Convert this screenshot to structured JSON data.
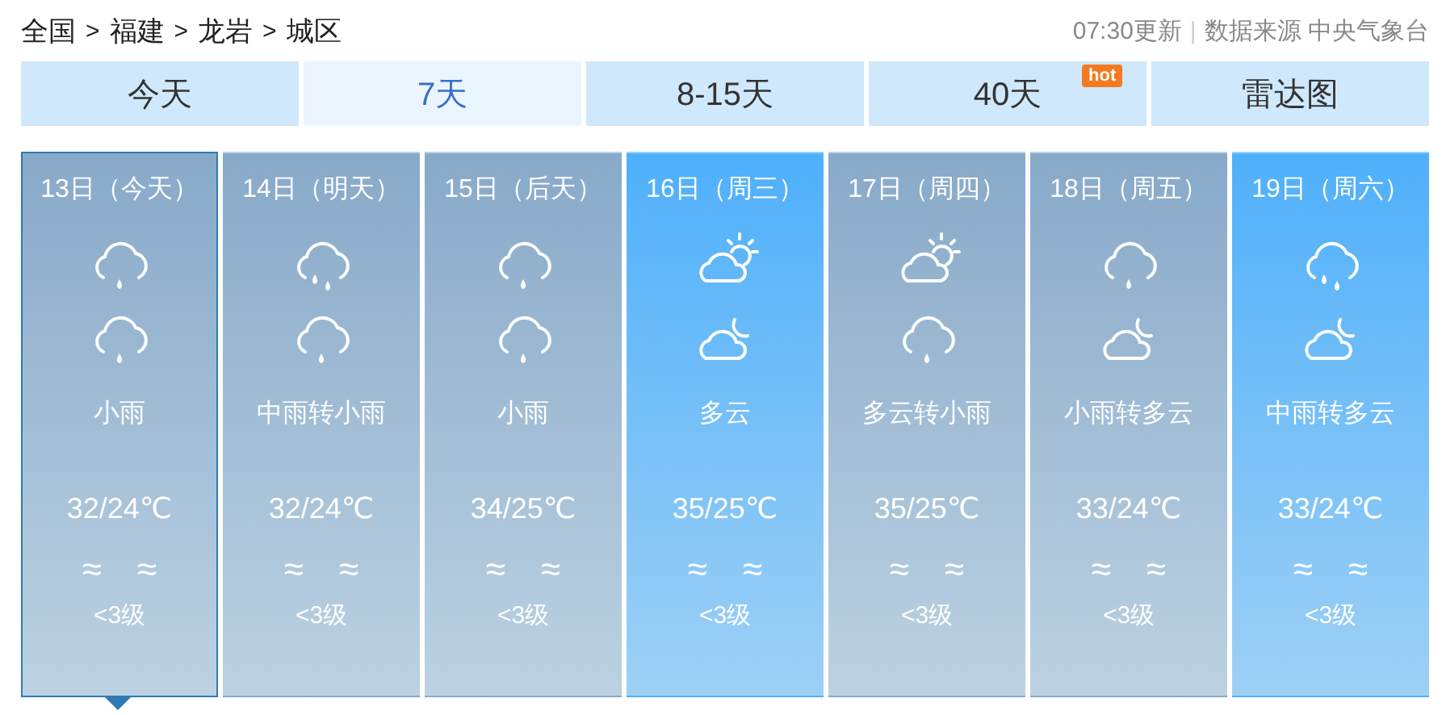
{
  "breadcrumb": {
    "items": [
      "全国",
      "福建",
      "龙岩",
      "城区"
    ],
    "separators": [
      ">",
      ">",
      ">"
    ]
  },
  "update": {
    "time": "07:30更新",
    "divider": "|",
    "source": "数据来源 中央气象台"
  },
  "tabs": [
    {
      "label": "今天",
      "selected": false
    },
    {
      "label": "7天",
      "selected": true
    },
    {
      "label": "8-15天",
      "selected": false
    },
    {
      "label": "40天",
      "selected": false,
      "badge": "hot"
    },
    {
      "label": "雷达图",
      "selected": false
    }
  ],
  "days": [
    {
      "date": "13日（今天）",
      "kind": "rain",
      "selected": true,
      "icons": [
        {
          "kind": "rain-one"
        },
        {
          "kind": "rain-one"
        }
      ],
      "weather": "小雨",
      "temp": "32/24℃",
      "wind_day": "≈",
      "wind_night": "≈",
      "wind_level": "<3级"
    },
    {
      "date": "14日（明天）",
      "kind": "rain",
      "selected": false,
      "icons": [
        {
          "kind": "rain-two"
        },
        {
          "kind": "rain-one"
        }
      ],
      "weather": "中雨转小雨",
      "temp": "32/24℃",
      "wind_day": "≈",
      "wind_night": "≈",
      "wind_level": "<3级"
    },
    {
      "date": "15日（后天）",
      "kind": "rain",
      "selected": false,
      "icons": [
        {
          "kind": "rain-one"
        },
        {
          "kind": "rain-one"
        }
      ],
      "weather": "小雨",
      "temp": "34/25℃",
      "wind_day": "≈",
      "wind_night": "≈",
      "wind_level": "<3级"
    },
    {
      "date": "16日（周三）",
      "kind": "clear",
      "selected": false,
      "icons": [
        {
          "kind": "sun-cloud"
        },
        {
          "kind": "moon-cloud"
        }
      ],
      "weather": "多云",
      "temp": "35/25℃",
      "wind_day": "≈",
      "wind_night": "≈",
      "wind_level": "<3级"
    },
    {
      "date": "17日（周四）",
      "kind": "rain",
      "selected": false,
      "icons": [
        {
          "kind": "sun-cloud"
        },
        {
          "kind": "rain-one"
        }
      ],
      "weather": "多云转小雨",
      "temp": "35/25℃",
      "wind_day": "≈",
      "wind_night": "≈",
      "wind_level": "<3级"
    },
    {
      "date": "18日（周五）",
      "kind": "rain",
      "selected": false,
      "icons": [
        {
          "kind": "rain-one"
        },
        {
          "kind": "moon-cloud"
        }
      ],
      "weather": "小雨转多云",
      "temp": "33/24℃",
      "wind_day": "≈",
      "wind_night": "≈",
      "wind_level": "<3级"
    },
    {
      "date": "19日（周六）",
      "kind": "clear",
      "selected": false,
      "icons": [
        {
          "kind": "rain-two"
        },
        {
          "kind": "moon-cloud"
        }
      ],
      "weather": "中雨转多云",
      "temp": "33/24℃",
      "wind_day": "≈",
      "wind_night": "≈",
      "wind_level": "<3级"
    }
  ]
}
